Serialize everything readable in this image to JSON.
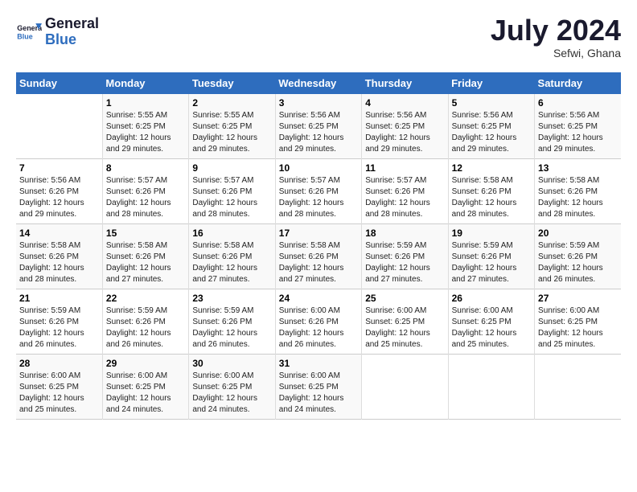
{
  "logo": {
    "line1": "General",
    "line2": "Blue"
  },
  "title": {
    "month_year": "July 2024",
    "location": "Sefwi, Ghana"
  },
  "days_of_week": [
    "Sunday",
    "Monday",
    "Tuesday",
    "Wednesday",
    "Thursday",
    "Friday",
    "Saturday"
  ],
  "weeks": [
    [
      {
        "day": "",
        "info": ""
      },
      {
        "day": "1",
        "info": "Sunrise: 5:55 AM\nSunset: 6:25 PM\nDaylight: 12 hours\nand 29 minutes."
      },
      {
        "day": "2",
        "info": "Sunrise: 5:55 AM\nSunset: 6:25 PM\nDaylight: 12 hours\nand 29 minutes."
      },
      {
        "day": "3",
        "info": "Sunrise: 5:56 AM\nSunset: 6:25 PM\nDaylight: 12 hours\nand 29 minutes."
      },
      {
        "day": "4",
        "info": "Sunrise: 5:56 AM\nSunset: 6:25 PM\nDaylight: 12 hours\nand 29 minutes."
      },
      {
        "day": "5",
        "info": "Sunrise: 5:56 AM\nSunset: 6:25 PM\nDaylight: 12 hours\nand 29 minutes."
      },
      {
        "day": "6",
        "info": "Sunrise: 5:56 AM\nSunset: 6:25 PM\nDaylight: 12 hours\nand 29 minutes."
      }
    ],
    [
      {
        "day": "7",
        "info": "Sunrise: 5:56 AM\nSunset: 6:26 PM\nDaylight: 12 hours\nand 29 minutes."
      },
      {
        "day": "8",
        "info": "Sunrise: 5:57 AM\nSunset: 6:26 PM\nDaylight: 12 hours\nand 28 minutes."
      },
      {
        "day": "9",
        "info": "Sunrise: 5:57 AM\nSunset: 6:26 PM\nDaylight: 12 hours\nand 28 minutes."
      },
      {
        "day": "10",
        "info": "Sunrise: 5:57 AM\nSunset: 6:26 PM\nDaylight: 12 hours\nand 28 minutes."
      },
      {
        "day": "11",
        "info": "Sunrise: 5:57 AM\nSunset: 6:26 PM\nDaylight: 12 hours\nand 28 minutes."
      },
      {
        "day": "12",
        "info": "Sunrise: 5:58 AM\nSunset: 6:26 PM\nDaylight: 12 hours\nand 28 minutes."
      },
      {
        "day": "13",
        "info": "Sunrise: 5:58 AM\nSunset: 6:26 PM\nDaylight: 12 hours\nand 28 minutes."
      }
    ],
    [
      {
        "day": "14",
        "info": "Sunrise: 5:58 AM\nSunset: 6:26 PM\nDaylight: 12 hours\nand 28 minutes."
      },
      {
        "day": "15",
        "info": "Sunrise: 5:58 AM\nSunset: 6:26 PM\nDaylight: 12 hours\nand 27 minutes."
      },
      {
        "day": "16",
        "info": "Sunrise: 5:58 AM\nSunset: 6:26 PM\nDaylight: 12 hours\nand 27 minutes."
      },
      {
        "day": "17",
        "info": "Sunrise: 5:58 AM\nSunset: 6:26 PM\nDaylight: 12 hours\nand 27 minutes."
      },
      {
        "day": "18",
        "info": "Sunrise: 5:59 AM\nSunset: 6:26 PM\nDaylight: 12 hours\nand 27 minutes."
      },
      {
        "day": "19",
        "info": "Sunrise: 5:59 AM\nSunset: 6:26 PM\nDaylight: 12 hours\nand 27 minutes."
      },
      {
        "day": "20",
        "info": "Sunrise: 5:59 AM\nSunset: 6:26 PM\nDaylight: 12 hours\nand 26 minutes."
      }
    ],
    [
      {
        "day": "21",
        "info": "Sunrise: 5:59 AM\nSunset: 6:26 PM\nDaylight: 12 hours\nand 26 minutes."
      },
      {
        "day": "22",
        "info": "Sunrise: 5:59 AM\nSunset: 6:26 PM\nDaylight: 12 hours\nand 26 minutes."
      },
      {
        "day": "23",
        "info": "Sunrise: 5:59 AM\nSunset: 6:26 PM\nDaylight: 12 hours\nand 26 minutes."
      },
      {
        "day": "24",
        "info": "Sunrise: 6:00 AM\nSunset: 6:26 PM\nDaylight: 12 hours\nand 26 minutes."
      },
      {
        "day": "25",
        "info": "Sunrise: 6:00 AM\nSunset: 6:25 PM\nDaylight: 12 hours\nand 25 minutes."
      },
      {
        "day": "26",
        "info": "Sunrise: 6:00 AM\nSunset: 6:25 PM\nDaylight: 12 hours\nand 25 minutes."
      },
      {
        "day": "27",
        "info": "Sunrise: 6:00 AM\nSunset: 6:25 PM\nDaylight: 12 hours\nand 25 minutes."
      }
    ],
    [
      {
        "day": "28",
        "info": "Sunrise: 6:00 AM\nSunset: 6:25 PM\nDaylight: 12 hours\nand 25 minutes."
      },
      {
        "day": "29",
        "info": "Sunrise: 6:00 AM\nSunset: 6:25 PM\nDaylight: 12 hours\nand 24 minutes."
      },
      {
        "day": "30",
        "info": "Sunrise: 6:00 AM\nSunset: 6:25 PM\nDaylight: 12 hours\nand 24 minutes."
      },
      {
        "day": "31",
        "info": "Sunrise: 6:00 AM\nSunset: 6:25 PM\nDaylight: 12 hours\nand 24 minutes."
      },
      {
        "day": "",
        "info": ""
      },
      {
        "day": "",
        "info": ""
      },
      {
        "day": "",
        "info": ""
      }
    ]
  ]
}
